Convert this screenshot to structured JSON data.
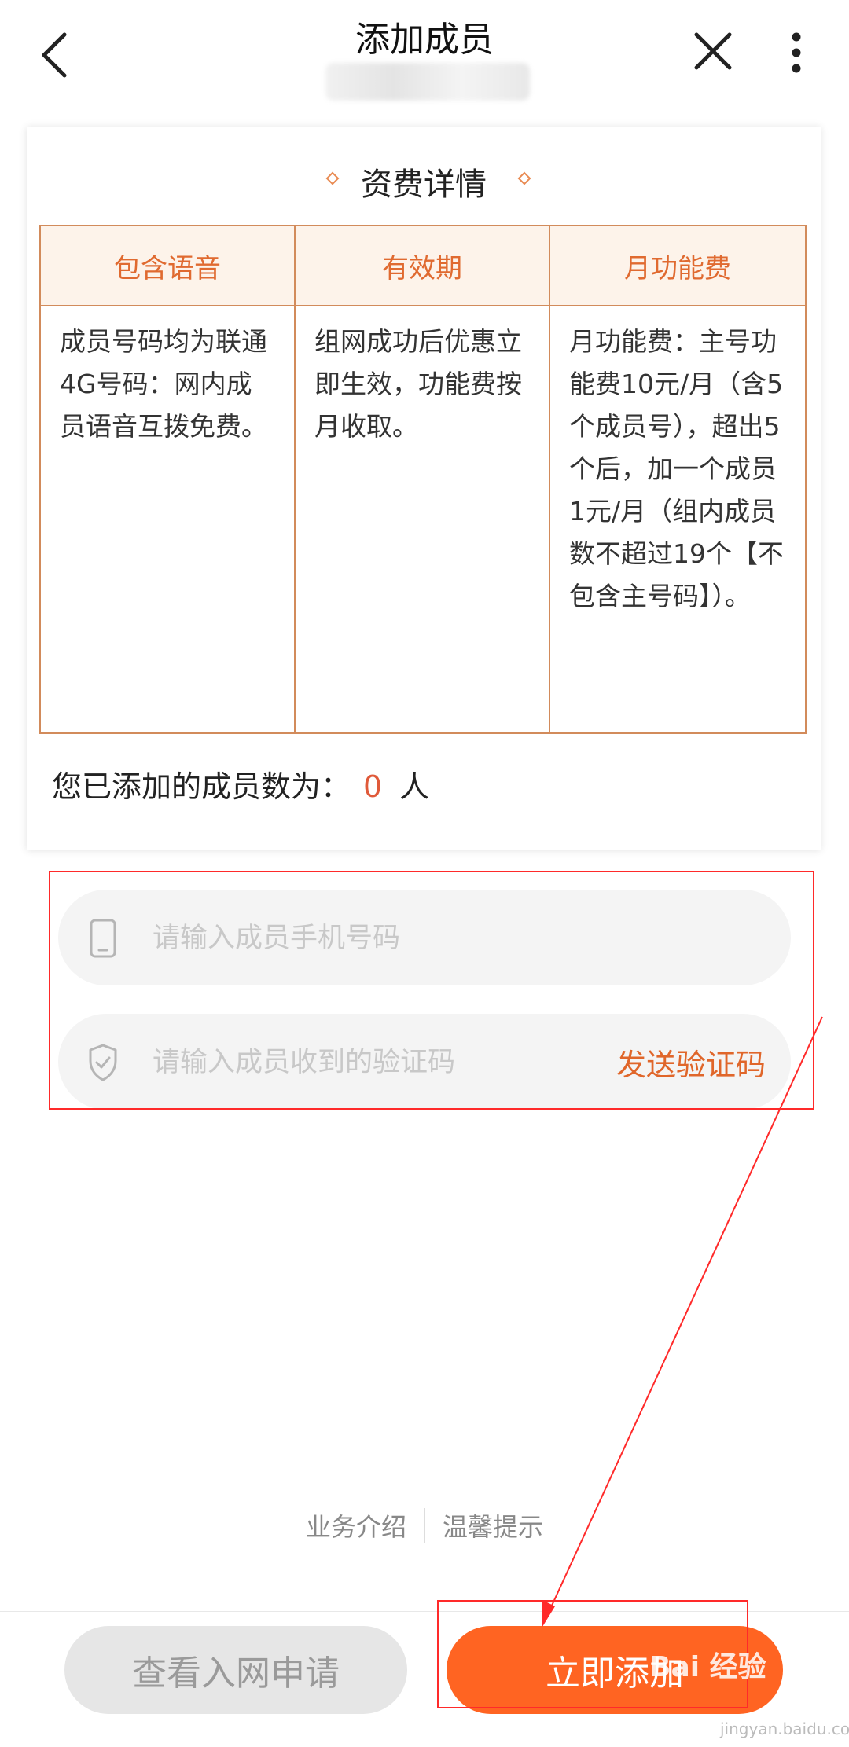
{
  "header": {
    "title": "添加成员",
    "icons": {
      "back": "chevron-left-icon",
      "close": "close-icon",
      "more": "more-vertical-icon"
    }
  },
  "card": {
    "title": "资费详情",
    "table": {
      "headers": [
        "包含语音",
        "有效期",
        "月功能费"
      ],
      "cells": [
        "成员号码均为联通4G号码：网内成员语音互拨免费。",
        "组网成功后优惠立即生效，功能费按月收取。",
        "月功能费：主号功能费10元/月（含5个成员号），超出5个后，加一个成员1元/月（组内成员数不超过19个【不包含主号码】）。"
      ]
    },
    "member_count": {
      "prefix": "您已添加的成员数为：",
      "count": "0",
      "suffix": "人"
    }
  },
  "form": {
    "phone_placeholder": "请输入成员手机号码",
    "code_placeholder": "请输入成员收到的验证码",
    "send_code_label": "发送验证码",
    "icons": {
      "phone": "phone-icon",
      "code": "shield-check-icon"
    }
  },
  "footer_links": {
    "intro": "业务介绍",
    "tips": "温馨提示"
  },
  "buttons": {
    "view_application": "查看入网申请",
    "add_now": "立即添加"
  },
  "watermark": {
    "main": "Bai 经验",
    "sub": "jingyan.baidu.com"
  },
  "colors": {
    "accent": "#ff6422",
    "table_border": "#d28b5b",
    "header_text": "#e06a30",
    "annotation": "#ff2a2a"
  }
}
